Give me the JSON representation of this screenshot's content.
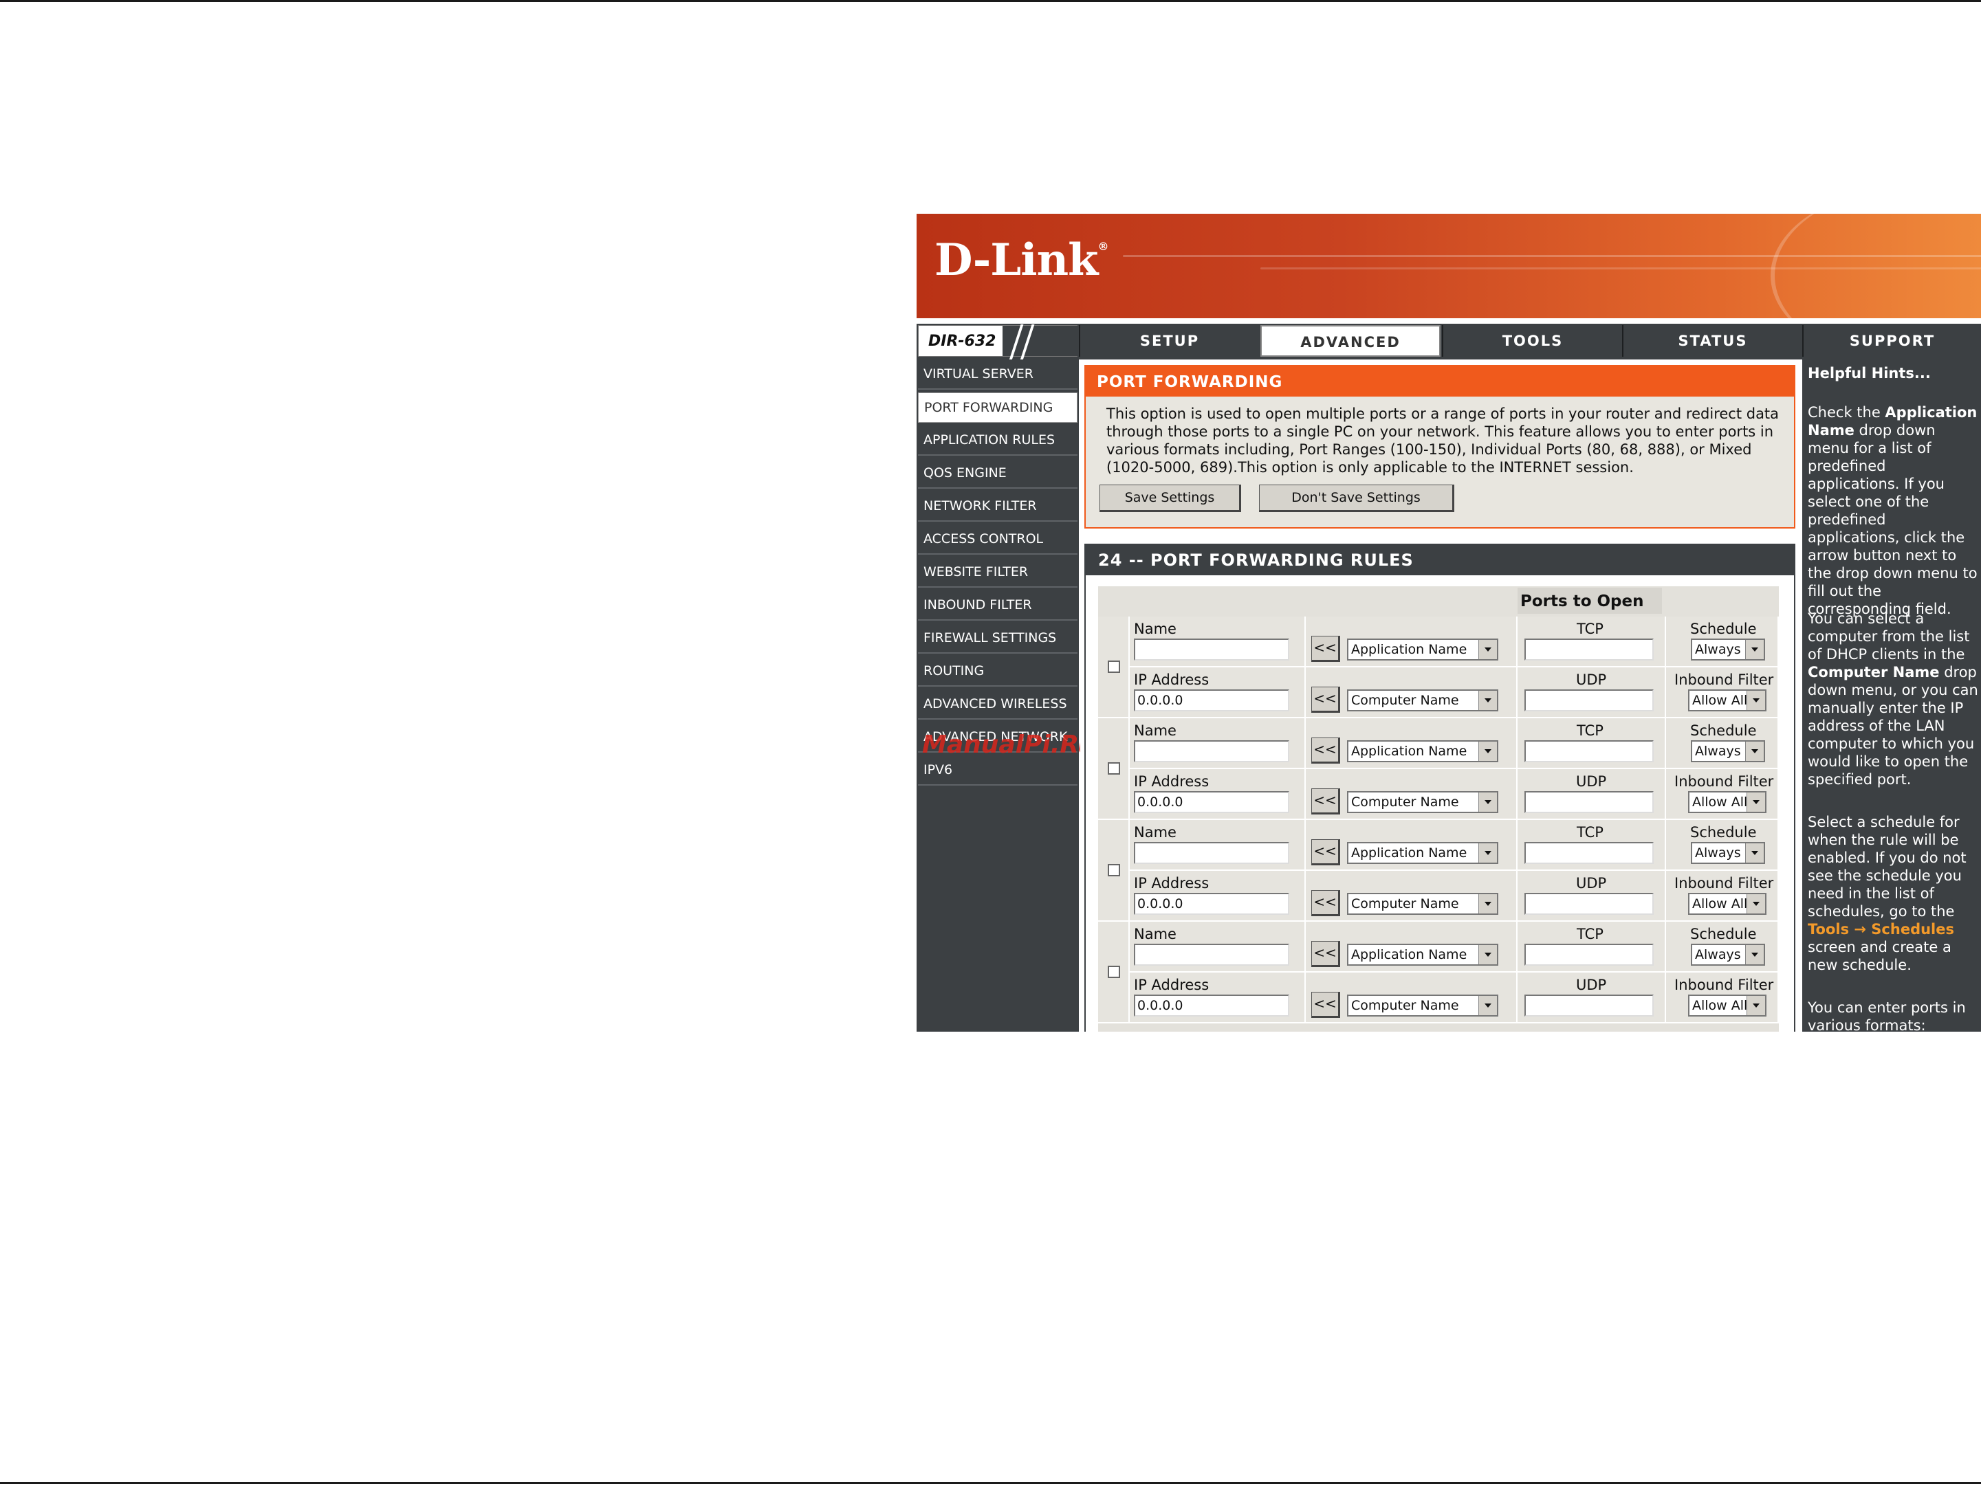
{
  "brand": {
    "logo_text": "D-Link",
    "reg_mark": "®"
  },
  "model": "DIR-632",
  "tabs": [
    {
      "label": "SETUP"
    },
    {
      "label": "ADVANCED"
    },
    {
      "label": "TOOLS"
    },
    {
      "label": "STATUS"
    },
    {
      "label": "SUPPORT"
    }
  ],
  "sidebar": {
    "items": [
      {
        "label": "VIRTUAL SERVER"
      },
      {
        "label": "PORT FORWARDING"
      },
      {
        "label": "APPLICATION RULES"
      },
      {
        "label": "QOS ENGINE"
      },
      {
        "label": "NETWORK FILTER"
      },
      {
        "label": "ACCESS CONTROL"
      },
      {
        "label": "WEBSITE FILTER"
      },
      {
        "label": "INBOUND FILTER"
      },
      {
        "label": "FIREWALL SETTINGS"
      },
      {
        "label": "ROUTING"
      },
      {
        "label": "ADVANCED WIRELESS"
      },
      {
        "label": "ADVANCED NETWORK"
      },
      {
        "label": "IPV6"
      }
    ],
    "watermark": "ManualPi.Ru"
  },
  "port_forwarding": {
    "title": "PORT FORWARDING",
    "description": "This option is used to open multiple ports or a range of ports in your router and redirect data through those ports to a single PC on your network. This feature allows you to enter ports in various formats including, Port Ranges (100-150), Individual Ports (80, 68, 888), or Mixed (1020-5000, 689).This option is only applicable to the INTERNET session.",
    "save_label": "Save Settings",
    "dont_save_label": "Don't Save Settings"
  },
  "rules": {
    "title": "24 -- PORT FORWARDING RULES",
    "ports_header": "Ports to Open",
    "labels": {
      "name": "Name",
      "ip": "IP Address",
      "tcp": "TCP",
      "udp": "UDP",
      "schedule": "Schedule",
      "inbound": "Inbound Filter",
      "arrow": "<<",
      "app_select": "Application Name",
      "computer_select": "Computer Name",
      "schedule_value": "Always",
      "inbound_value": "Allow All"
    },
    "rows": [
      {
        "name": "",
        "ip": "0.0.0.0",
        "tcp": "",
        "udp": ""
      },
      {
        "name": "",
        "ip": "0.0.0.0",
        "tcp": "",
        "udp": ""
      },
      {
        "name": "",
        "ip": "0.0.0.0",
        "tcp": "",
        "udp": ""
      },
      {
        "name": "",
        "ip": "0.0.0.0",
        "tcp": "",
        "udp": ""
      }
    ]
  },
  "hints": {
    "title": "Helpful Hints...",
    "p1": {
      "a": "Check the ",
      "b": "Application Name",
      "c": " drop down menu for a list of predefined applications. If you select one of the predefined applications, click the arrow button next to the drop down menu to fill out the corresponding field."
    },
    "p2": {
      "a": "You can select a computer from the list of DHCP clients in the ",
      "b": "Computer Name",
      "c": " drop down menu, or you can manually enter the IP address of the LAN computer to which you would like to open the specified port."
    },
    "p3": {
      "a": "Select a schedule for when the rule will be enabled. If you do not see the schedule you need in the list of schedules, go to the ",
      "link": "Tools → Schedules",
      "c": " screen and create a new schedule."
    },
    "p4": "You can enter ports in various formats:"
  }
}
